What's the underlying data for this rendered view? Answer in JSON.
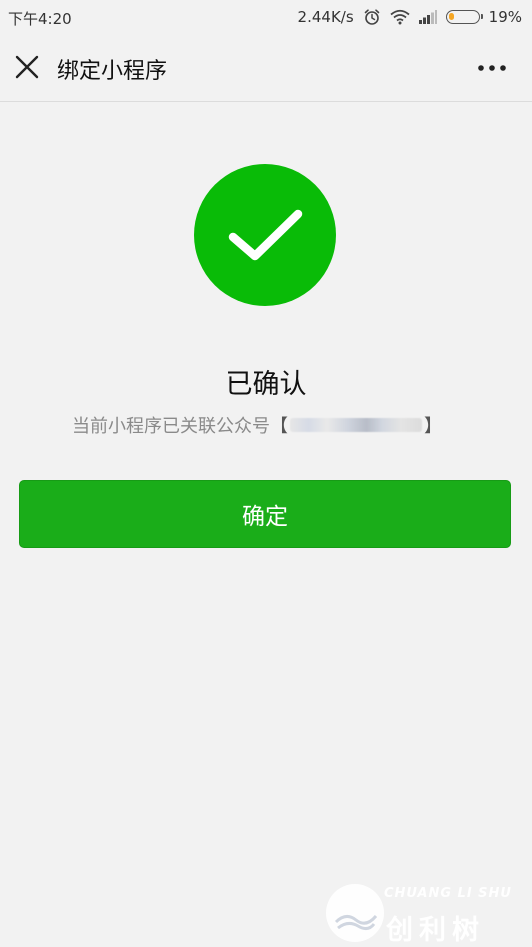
{
  "status_bar": {
    "time": "下午4:20",
    "network_speed": "2.44K/s",
    "battery_percent": "19%",
    "battery_level": 0.19,
    "icons": [
      "alarm-icon",
      "wifi-icon",
      "signal-icon",
      "battery-icon"
    ]
  },
  "nav": {
    "title": "绑定小程序",
    "close_icon": "close-icon",
    "more_icon": "more-icon"
  },
  "result": {
    "icon": "checkmark-icon",
    "icon_color": "#09bb07",
    "title": "已确认",
    "description_prefix": "当前小程序已关联公众号",
    "bracket_open": "【",
    "bracket_close": "】"
  },
  "actions": {
    "confirm_label": "确定",
    "confirm_color": "#1aad19"
  },
  "watermark": {
    "text_en": "CHUANG LI SHU",
    "text_cn": "创利树"
  }
}
